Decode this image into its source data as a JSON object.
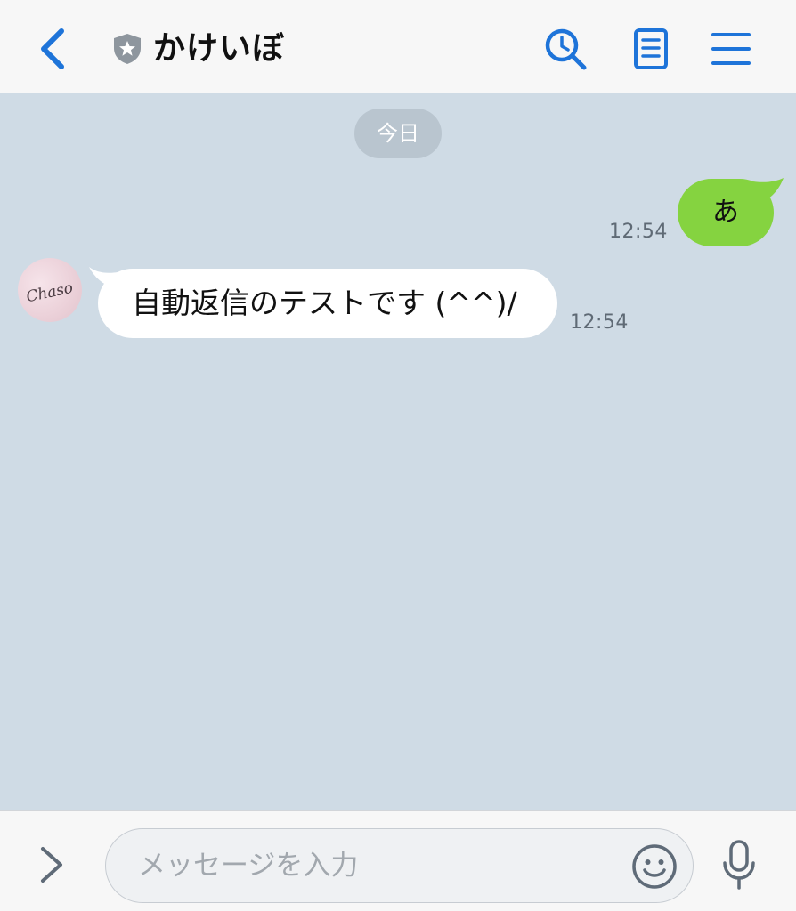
{
  "header": {
    "title": "かけいぼ",
    "icons": {
      "back": "chevron-left-icon",
      "badge": "shield-star-icon",
      "search": "search-clock-icon",
      "notes": "note-icon",
      "menu": "hamburger-menu-icon"
    }
  },
  "chat": {
    "date_label": "今日",
    "messages": [
      {
        "sender": "me",
        "text": "あ",
        "time": "12:54"
      },
      {
        "sender": "Chaso",
        "text": "自動返信のテストです (^^)/",
        "time": "12:54"
      }
    ],
    "avatar_text": "Chaso"
  },
  "composer": {
    "placeholder": "メッセージを入力",
    "value": "",
    "icons": {
      "expand": "chevron-right-icon",
      "emoji": "smiley-icon",
      "mic": "microphone-icon"
    }
  },
  "colors": {
    "accent": "#1e74d9",
    "chat_background": "#cfdbe5",
    "outgoing_bubble": "#85d340",
    "incoming_bubble": "#ffffff",
    "date_pill": "#b9c5cf",
    "header_background": "#f7f7f7"
  }
}
